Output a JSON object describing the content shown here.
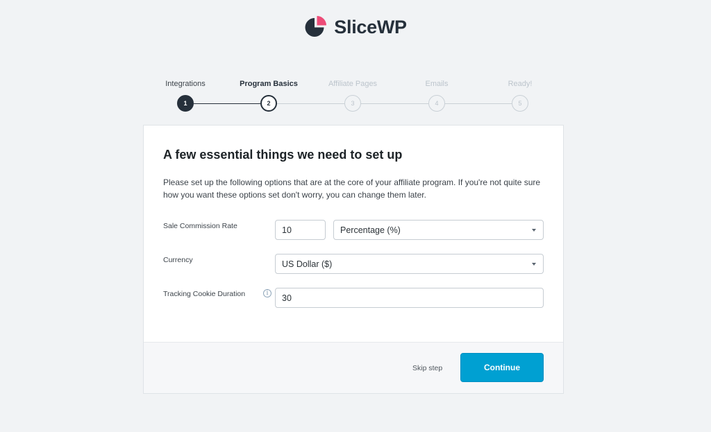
{
  "brand": {
    "name": "SliceWP",
    "logo_icon": "pie-chart-logo-icon",
    "logo_dark": "#26303b",
    "logo_accent": "#ed4c78"
  },
  "steps": [
    {
      "label": "Integrations",
      "number": "1",
      "state": "done"
    },
    {
      "label": "Program Basics",
      "number": "2",
      "state": "current"
    },
    {
      "label": "Affiliate Pages",
      "number": "3",
      "state": "upcoming"
    },
    {
      "label": "Emails",
      "number": "4",
      "state": "upcoming"
    },
    {
      "label": "Ready!",
      "number": "5",
      "state": "upcoming"
    }
  ],
  "card": {
    "title": "A few essential things we need to set up",
    "description": "Please set up the following options that are at the core of your affiliate program. If you're not quite sure how you want these options set don't worry, you can change them later."
  },
  "fields": {
    "commission": {
      "label": "Sale Commission Rate",
      "value": "10",
      "type_value": "Percentage (%)"
    },
    "currency": {
      "label": "Currency",
      "value": "US Dollar ($)"
    },
    "cookie": {
      "label": "Tracking Cookie Duration",
      "value": "30",
      "info_icon": "info-icon"
    }
  },
  "actions": {
    "skip_label": "Skip step",
    "continue_label": "Continue",
    "continue_color": "#00a0d2"
  }
}
